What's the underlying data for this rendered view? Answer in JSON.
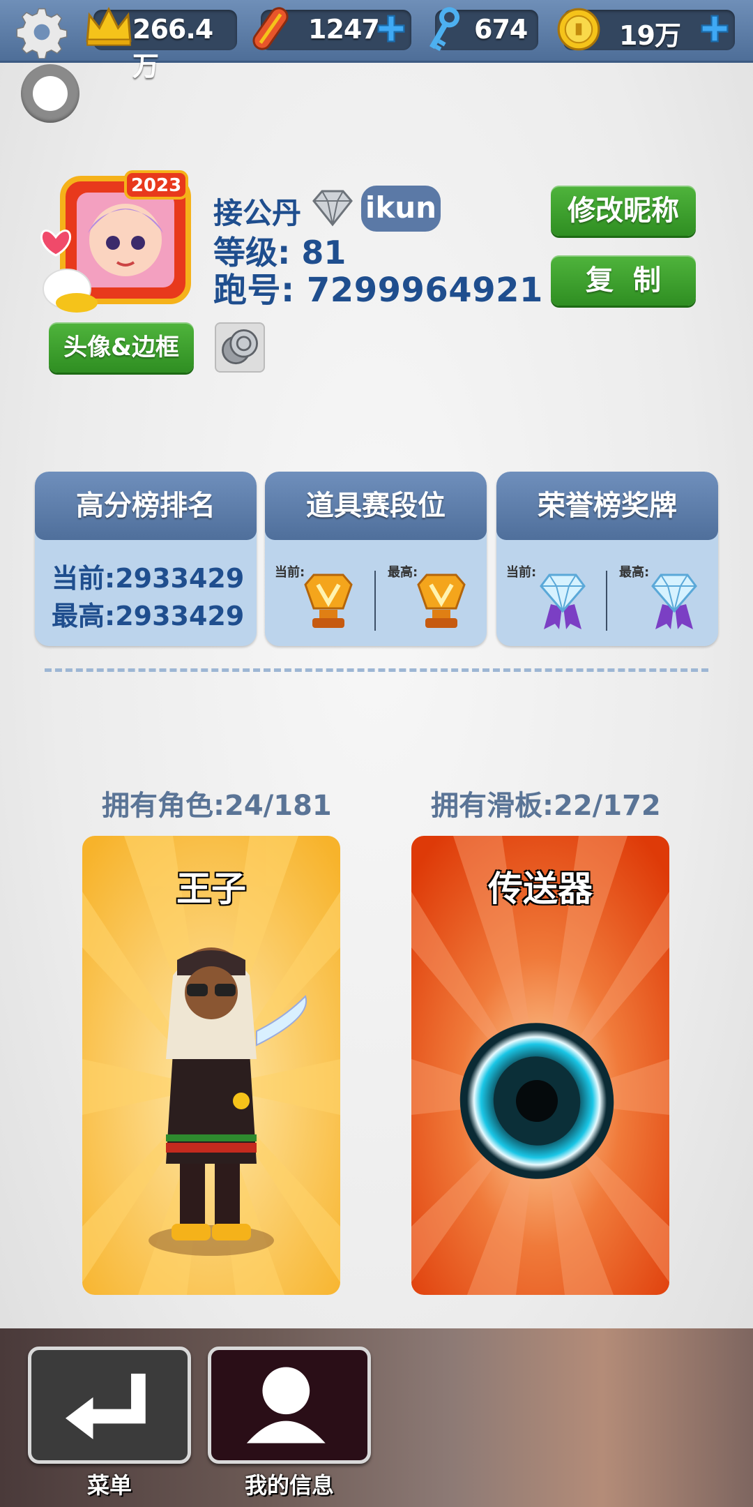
{
  "topbar": {
    "settings_icon": "gear-icon",
    "resources": [
      {
        "name": "crown",
        "icon": "crown-icon",
        "value": "266.4万",
        "has_plus": false
      },
      {
        "name": "hoverboard",
        "icon": "hoverboard-icon",
        "value": "1247",
        "has_plus": true
      },
      {
        "name": "key",
        "icon": "key-icon",
        "value": "674",
        "has_plus": false
      },
      {
        "name": "coin",
        "icon": "coin-icon",
        "value": "19万",
        "has_plus": true
      }
    ]
  },
  "profile": {
    "nickname": "接公丹",
    "tag": "ikun",
    "level": "等级: 81",
    "player_id": "跑号: 7299964921",
    "avatar_year": "2023",
    "rename_label": "修改昵称",
    "copy_label": "复制",
    "avatar_frame_label": "头像&边框"
  },
  "stats": {
    "highscore": {
      "title": "高分榜排名",
      "current": "当前:2933429",
      "best": "最高:2933429"
    },
    "item_league": {
      "title": "道具赛段位",
      "current_label": "当前:",
      "best_label": "最高:"
    },
    "honor": {
      "title": "荣誉榜奖牌",
      "current_label": "当前:",
      "best_label": "最高:"
    }
  },
  "owned": {
    "characters_label": "拥有角色:24/181",
    "boards_label": "拥有滑板:22/172",
    "character_name": "王子",
    "board_name": "传送器"
  },
  "nav": {
    "menu_label": "菜单",
    "info_label": "我的信息"
  },
  "colors": {
    "accent_blue": "#1f4e8e",
    "green_button": "#3a9e2c",
    "card_bg": "#bcd4ec"
  }
}
